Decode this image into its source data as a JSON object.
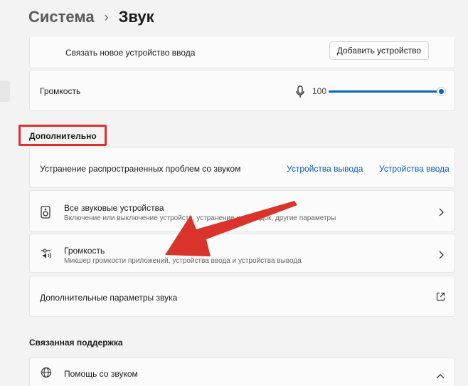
{
  "breadcrumb": {
    "parent": "Система",
    "separator": "›",
    "current": "Звук"
  },
  "pair_input": {
    "label": "Связать новое устройство ввода",
    "button": "Добавить устройство"
  },
  "volume": {
    "label": "Громкость",
    "value": "100",
    "level_percent": 100
  },
  "advanced": {
    "heading": "Дополнительно",
    "troubleshoot": {
      "label": "Устранение распространенных проблем со звуком",
      "link_output": "Устройства вывода",
      "link_input": "Устройства ввода"
    },
    "all_devices": {
      "title": "Все звуковые устройства",
      "subtitle": "Включение или выключение устройств, устранение неполадок, другие параметры"
    },
    "volume_mixer": {
      "title": "Громкость",
      "subtitle": "Микшер громкости приложений, устройства ввода и устройства вывода"
    },
    "more_settings": {
      "label": "Дополнительные параметры звука"
    }
  },
  "support": {
    "heading": "Связанная поддержка",
    "help": {
      "label": "Помощь со звуком"
    }
  },
  "colors": {
    "accent": "#0067c0",
    "link": "#0a5cb8",
    "annotation_red": "#d9332b"
  }
}
